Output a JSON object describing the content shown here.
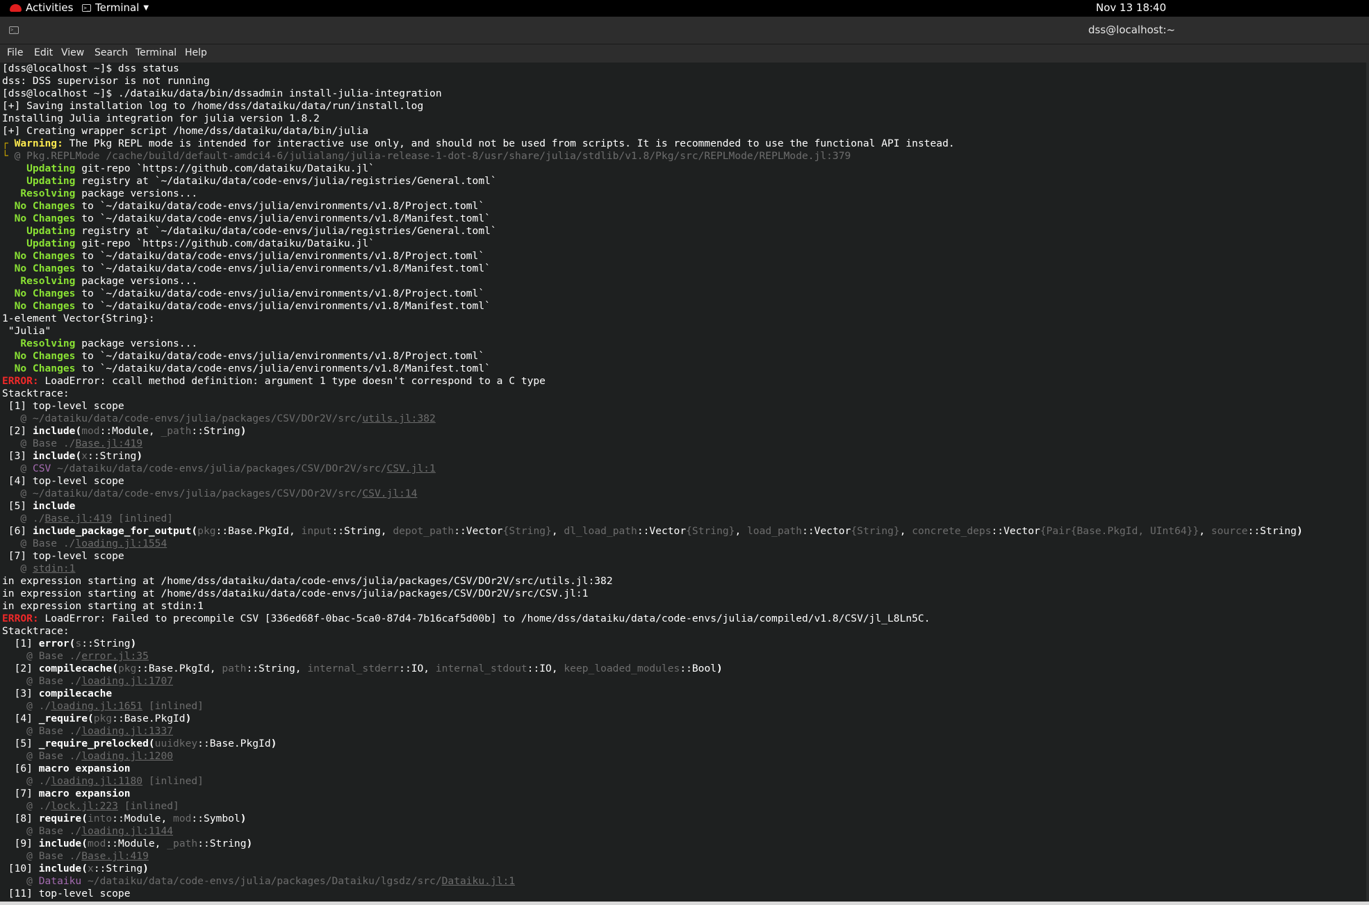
{
  "topbar": {
    "activities": "Activities",
    "app_name": "Terminal",
    "clock": "Nov 13  18:40"
  },
  "window": {
    "title": "dss@localhost:~",
    "icon": "terminal-icon"
  },
  "menu": [
    "File",
    "Edit",
    "View",
    "Search",
    "Terminal",
    "Help"
  ],
  "colors": {
    "background": "#1e2020",
    "green": "#8ae234",
    "yellow": "#fce94f",
    "red": "#ef2929",
    "dim": "#6d6d6d",
    "purple": "#a46bb0"
  },
  "terminal_lines": [
    [
      [
        "",
        "[dss@localhost ~]$ dss status"
      ]
    ],
    [
      [
        "",
        "dss: DSS supervisor is not running"
      ]
    ],
    [
      [
        "",
        "[dss@localhost ~]$ ./dataiku/data/bin/dssadmin install-julia-integration"
      ]
    ],
    [
      [
        "",
        "[+] Saving installation log to /home/dss/dataiku/data/run/install.log"
      ]
    ],
    [
      [
        "",
        "Installing Julia integration for julia version 1.8.2"
      ]
    ],
    [
      [
        "",
        "[+] Creating wrapper script /home/dss/dataiku/data/bin/julia"
      ]
    ],
    [
      [
        "bracket",
        "┌ "
      ],
      [
        "yellow",
        "Warning:"
      ],
      [
        "",
        " The Pkg REPL mode is intended for interactive use only, and should not be used from scripts. It is recommended to use the functional API instead."
      ]
    ],
    [
      [
        "bracket",
        "└ "
      ],
      [
        "dim",
        "@ Pkg.REPLMode /cache/build/default-amdci4-6/julialang/julia-release-1-dot-8/usr/share/julia/stdlib/v1.8/Pkg/src/REPLMode/REPLMode.jl:379"
      ]
    ],
    [
      [
        "green",
        "    Updating"
      ],
      [
        "",
        " git-repo `https://github.com/dataiku/Dataiku.jl`"
      ]
    ],
    [
      [
        "green",
        "    Updating"
      ],
      [
        "",
        " registry at `~/dataiku/data/code-envs/julia/registries/General.toml`"
      ]
    ],
    [
      [
        "green",
        "   Resolving"
      ],
      [
        "",
        " package versions..."
      ]
    ],
    [
      [
        "green",
        "  No Changes"
      ],
      [
        "",
        " to `~/dataiku/data/code-envs/julia/environments/v1.8/Project.toml`"
      ]
    ],
    [
      [
        "green",
        "  No Changes"
      ],
      [
        "",
        " to `~/dataiku/data/code-envs/julia/environments/v1.8/Manifest.toml`"
      ]
    ],
    [
      [
        "green",
        "    Updating"
      ],
      [
        "",
        " registry at `~/dataiku/data/code-envs/julia/registries/General.toml`"
      ]
    ],
    [
      [
        "green",
        "    Updating"
      ],
      [
        "",
        " git-repo `https://github.com/dataiku/Dataiku.jl`"
      ]
    ],
    [
      [
        "green",
        "  No Changes"
      ],
      [
        "",
        " to `~/dataiku/data/code-envs/julia/environments/v1.8/Project.toml`"
      ]
    ],
    [
      [
        "green",
        "  No Changes"
      ],
      [
        "",
        " to `~/dataiku/data/code-envs/julia/environments/v1.8/Manifest.toml`"
      ]
    ],
    [
      [
        "green",
        "   Resolving"
      ],
      [
        "",
        " package versions..."
      ]
    ],
    [
      [
        "green",
        "  No Changes"
      ],
      [
        "",
        " to `~/dataiku/data/code-envs/julia/environments/v1.8/Project.toml`"
      ]
    ],
    [
      [
        "green",
        "  No Changes"
      ],
      [
        "",
        " to `~/dataiku/data/code-envs/julia/environments/v1.8/Manifest.toml`"
      ]
    ],
    [
      [
        "",
        "1-element Vector{String}:"
      ]
    ],
    [
      [
        "",
        " \"Julia\""
      ]
    ],
    [
      [
        "green",
        "   Resolving"
      ],
      [
        "",
        " package versions..."
      ]
    ],
    [
      [
        "green",
        "  No Changes"
      ],
      [
        "",
        " to `~/dataiku/data/code-envs/julia/environments/v1.8/Project.toml`"
      ]
    ],
    [
      [
        "green",
        "  No Changes"
      ],
      [
        "",
        " to `~/dataiku/data/code-envs/julia/environments/v1.8/Manifest.toml`"
      ]
    ],
    [
      [
        "red",
        "ERROR:"
      ],
      [
        "",
        " LoadError: ccall method definition: argument 1 type doesn't correspond to a C type"
      ]
    ],
    [
      [
        "",
        "Stacktrace:"
      ]
    ],
    [
      [
        "",
        " [1] top-level scope"
      ]
    ],
    [
      [
        "dim",
        "   @ ~/dataiku/data/code-envs/julia/packages/CSV/DOr2V/src/"
      ],
      [
        "dimu",
        "utils.jl:382"
      ]
    ],
    [
      [
        "",
        " [2] "
      ],
      [
        "bold",
        "include("
      ],
      [
        "dim",
        "mod"
      ],
      [
        "",
        "::Module, "
      ],
      [
        "dim",
        "_path"
      ],
      [
        "",
        "::String"
      ],
      [
        "bold",
        ")"
      ]
    ],
    [
      [
        "dim",
        "   @ Base ./"
      ],
      [
        "dimu",
        "Base.jl:419"
      ]
    ],
    [
      [
        "",
        " [3] "
      ],
      [
        "bold",
        "include("
      ],
      [
        "dim",
        "x"
      ],
      [
        "",
        "::String"
      ],
      [
        "bold",
        ")"
      ]
    ],
    [
      [
        "dim",
        "   @ "
      ],
      [
        "purple",
        "CSV"
      ],
      [
        "dim",
        " ~/dataiku/data/code-envs/julia/packages/CSV/DOr2V/src/"
      ],
      [
        "dimu",
        "CSV.jl:1"
      ]
    ],
    [
      [
        "",
        " [4] top-level scope"
      ]
    ],
    [
      [
        "dim",
        "   @ ~/dataiku/data/code-envs/julia/packages/CSV/DOr2V/src/"
      ],
      [
        "dimu",
        "CSV.jl:14"
      ]
    ],
    [
      [
        "",
        " [5] "
      ],
      [
        "bold",
        "include"
      ]
    ],
    [
      [
        "dim",
        "   @ ./"
      ],
      [
        "dimu",
        "Base.jl:419"
      ],
      [
        "dim",
        " [inlined]"
      ]
    ],
    [
      [
        "",
        " [6] "
      ],
      [
        "bold",
        "include_package_for_output("
      ],
      [
        "dim",
        "pkg"
      ],
      [
        "",
        "::Base.PkgId, "
      ],
      [
        "dim",
        "input"
      ],
      [
        "",
        "::String, "
      ],
      [
        "dim",
        "depot_path"
      ],
      [
        "",
        "::Vector"
      ],
      [
        "dim",
        "{String}"
      ],
      [
        "",
        ", "
      ],
      [
        "dim",
        "dl_load_path"
      ],
      [
        "",
        "::Vector"
      ],
      [
        "dim",
        "{String}"
      ],
      [
        "",
        ", "
      ],
      [
        "dim",
        "load_path"
      ],
      [
        "",
        "::Vector"
      ],
      [
        "dim",
        "{String}"
      ],
      [
        "",
        ", "
      ],
      [
        "dim",
        "concrete_deps"
      ],
      [
        "",
        "::Vector"
      ],
      [
        "dim",
        "{Pair{Base.PkgId, UInt64}}"
      ],
      [
        "",
        ", "
      ],
      [
        "dim",
        "source"
      ],
      [
        "",
        "::String"
      ],
      [
        "bold",
        ")"
      ]
    ],
    [
      [
        "dim",
        "   @ Base ./"
      ],
      [
        "dimu",
        "loading.jl:1554"
      ]
    ],
    [
      [
        "",
        " [7] top-level scope"
      ]
    ],
    [
      [
        "dim",
        "   @ "
      ],
      [
        "dimu",
        "stdin:1"
      ]
    ],
    [
      [
        "",
        "in expression starting at /home/dss/dataiku/data/code-envs/julia/packages/CSV/DOr2V/src/utils.jl:382"
      ]
    ],
    [
      [
        "",
        "in expression starting at /home/dss/dataiku/data/code-envs/julia/packages/CSV/DOr2V/src/CSV.jl:1"
      ]
    ],
    [
      [
        "",
        "in expression starting at stdin:1"
      ]
    ],
    [
      [
        "red",
        "ERROR:"
      ],
      [
        "",
        " LoadError: Failed to precompile CSV [336ed68f-0bac-5ca0-87d4-7b16caf5d00b] to /home/dss/dataiku/data/code-envs/julia/compiled/v1.8/CSV/jl_L8Ln5C."
      ]
    ],
    [
      [
        "",
        "Stacktrace:"
      ]
    ],
    [
      [
        "",
        "  [1] "
      ],
      [
        "bold",
        "error("
      ],
      [
        "dim",
        "s"
      ],
      [
        "",
        "::String"
      ],
      [
        "bold",
        ")"
      ]
    ],
    [
      [
        "dim",
        "    @ Base ./"
      ],
      [
        "dimu",
        "error.jl:35"
      ]
    ],
    [
      [
        "",
        "  [2] "
      ],
      [
        "bold",
        "compilecache("
      ],
      [
        "dim",
        "pkg"
      ],
      [
        "",
        "::Base.PkgId, "
      ],
      [
        "dim",
        "path"
      ],
      [
        "",
        "::String, "
      ],
      [
        "dim",
        "internal_stderr"
      ],
      [
        "",
        "::IO, "
      ],
      [
        "dim",
        "internal_stdout"
      ],
      [
        "",
        "::IO, "
      ],
      [
        "dim",
        "keep_loaded_modules"
      ],
      [
        "",
        "::Bool"
      ],
      [
        "bold",
        ")"
      ]
    ],
    [
      [
        "dim",
        "    @ Base ./"
      ],
      [
        "dimu",
        "loading.jl:1707"
      ]
    ],
    [
      [
        "",
        "  [3] "
      ],
      [
        "bold",
        "compilecache"
      ]
    ],
    [
      [
        "dim",
        "    @ ./"
      ],
      [
        "dimu",
        "loading.jl:1651"
      ],
      [
        "dim",
        " [inlined]"
      ]
    ],
    [
      [
        "",
        "  [4] "
      ],
      [
        "bold",
        "_require("
      ],
      [
        "dim",
        "pkg"
      ],
      [
        "",
        "::Base.PkgId"
      ],
      [
        "bold",
        ")"
      ]
    ],
    [
      [
        "dim",
        "    @ Base ./"
      ],
      [
        "dimu",
        "loading.jl:1337"
      ]
    ],
    [
      [
        "",
        "  [5] "
      ],
      [
        "bold",
        "_require_prelocked("
      ],
      [
        "dim",
        "uuidkey"
      ],
      [
        "",
        "::Base.PkgId"
      ],
      [
        "bold",
        ")"
      ]
    ],
    [
      [
        "dim",
        "    @ Base ./"
      ],
      [
        "dimu",
        "loading.jl:1200"
      ]
    ],
    [
      [
        "",
        "  [6] "
      ],
      [
        "bold",
        "macro expansion"
      ]
    ],
    [
      [
        "dim",
        "    @ ./"
      ],
      [
        "dimu",
        "loading.jl:1180"
      ],
      [
        "dim",
        " [inlined]"
      ]
    ],
    [
      [
        "",
        "  [7] "
      ],
      [
        "bold",
        "macro expansion"
      ]
    ],
    [
      [
        "dim",
        "    @ ./"
      ],
      [
        "dimu",
        "lock.jl:223"
      ],
      [
        "dim",
        " [inlined]"
      ]
    ],
    [
      [
        "",
        "  [8] "
      ],
      [
        "bold",
        "require("
      ],
      [
        "dim",
        "into"
      ],
      [
        "",
        "::Module, "
      ],
      [
        "dim",
        "mod"
      ],
      [
        "",
        "::Symbol"
      ],
      [
        "bold",
        ")"
      ]
    ],
    [
      [
        "dim",
        "    @ Base ./"
      ],
      [
        "dimu",
        "loading.jl:1144"
      ]
    ],
    [
      [
        "",
        "  [9] "
      ],
      [
        "bold",
        "include("
      ],
      [
        "dim",
        "mod"
      ],
      [
        "",
        "::Module, "
      ],
      [
        "dim",
        "_path"
      ],
      [
        "",
        "::String"
      ],
      [
        "bold",
        ")"
      ]
    ],
    [
      [
        "dim",
        "    @ Base ./"
      ],
      [
        "dimu",
        "Base.jl:419"
      ]
    ],
    [
      [
        "",
        " [10] "
      ],
      [
        "bold",
        "include("
      ],
      [
        "dim",
        "x"
      ],
      [
        "",
        "::String"
      ],
      [
        "bold",
        ")"
      ]
    ],
    [
      [
        "dim",
        "    @ "
      ],
      [
        "purple",
        "Dataiku"
      ],
      [
        "dim",
        " ~/dataiku/data/code-envs/julia/packages/Dataiku/lgsdz/src/"
      ],
      [
        "dimu",
        "Dataiku.jl:1"
      ]
    ],
    [
      [
        "",
        " [11] top-level scope"
      ]
    ]
  ]
}
